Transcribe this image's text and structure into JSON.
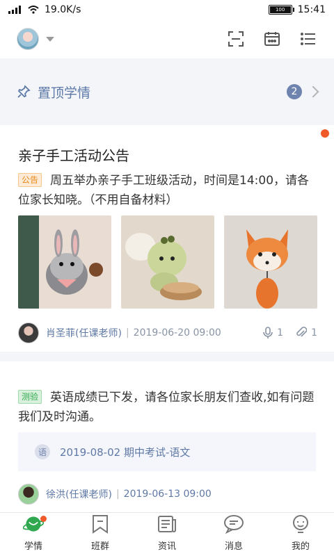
{
  "status": {
    "speed": "19.0K/s",
    "battery": "100",
    "time": "15:41"
  },
  "pinned": {
    "label": "置顶学情",
    "count": "2"
  },
  "notice": {
    "title": "亲子手工活动公告",
    "tag": "公告",
    "content": "周五举办亲子手工班级活动，时间是14:00，请各位家长知晓。（不用自备材料）",
    "author": "肖圣菲(任课老师)",
    "sep": "|",
    "datetime": "2019-06-20 09:00",
    "voice_count": "1",
    "attach_count": "1"
  },
  "quiz": {
    "tag": "测验",
    "content": "英语成绩已下发，请各位家长朋友们查收,如有问题我们及时沟通。",
    "ref_badge": "语",
    "ref_text": "2019-08-02 期中考试-语文",
    "author": "徐洪(任课老师)",
    "sep": "|",
    "datetime": "2019-06-13 09:00"
  },
  "nav": [
    {
      "label": "学情",
      "icon": "planet-icon",
      "active": true
    },
    {
      "label": "班群",
      "icon": "bookmark-icon"
    },
    {
      "label": "资讯",
      "icon": "news-icon"
    },
    {
      "label": "消息",
      "icon": "chat-icon"
    },
    {
      "label": "我的",
      "icon": "profile-icon"
    }
  ],
  "colors": {
    "accent": "#5d79a8",
    "badge": "#f05a28",
    "nav_active": "#2fa84f"
  }
}
